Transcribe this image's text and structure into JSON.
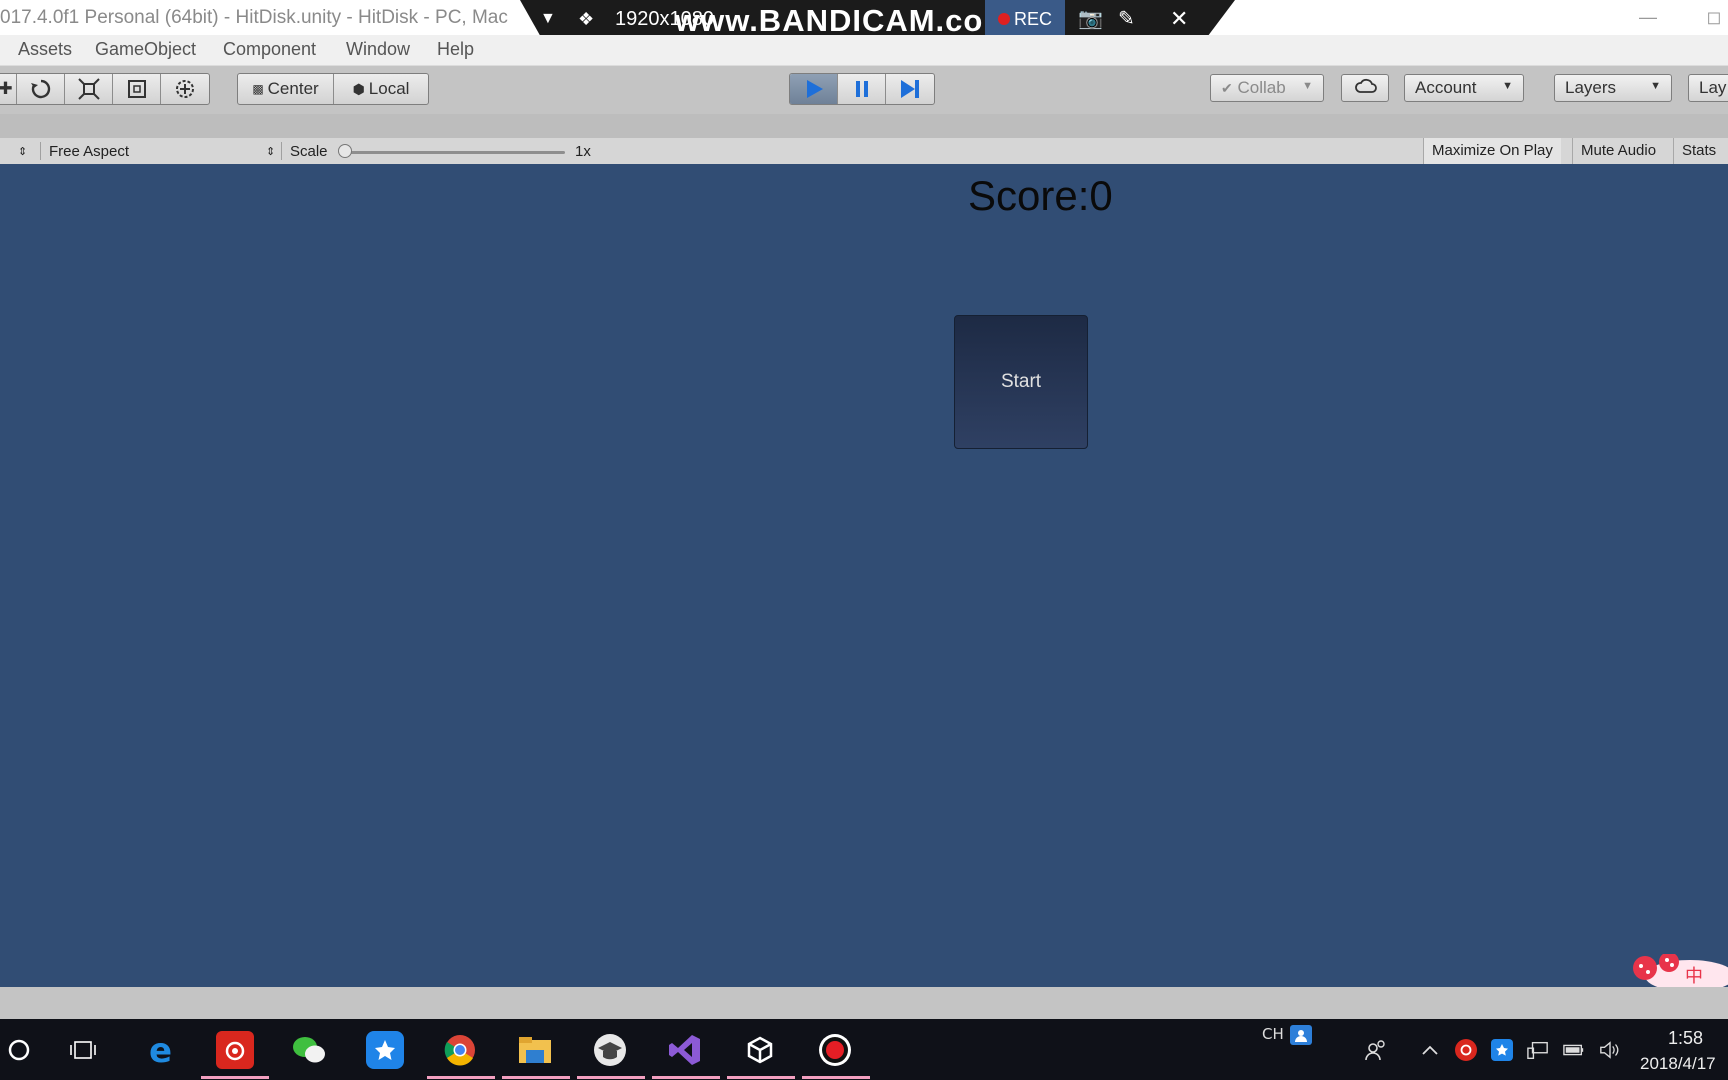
{
  "window": {
    "title": "017.4.0f1 Personal (64bit) - HitDisk.unity - HitDisk - PC, Mac",
    "minimize_icon": "minimize-icon",
    "maximize_icon": "maximize-icon"
  },
  "bandicam": {
    "resolution": "1920x1080",
    "watermark": "www.BANDICAM.com",
    "rec_label": "REC"
  },
  "menu": [
    "Assets",
    "GameObject",
    "Component",
    "Window",
    "Help"
  ],
  "toolbar": {
    "pivot_label": "Center",
    "space_label": "Local",
    "collab_label": "Collab",
    "account_label": "Account",
    "layers_label": "Layers",
    "layout_label": "Lay"
  },
  "game_view": {
    "aspect": "Free Aspect",
    "scale_label": "Scale",
    "scale_value": "1x",
    "scale_level": 0.0,
    "maximize_on_play": "Maximize On Play",
    "mute_audio": "Mute Audio",
    "stats": "Stats"
  },
  "game": {
    "score_text": "Score:0",
    "start_label": "Start",
    "background_color": "#314d74"
  },
  "taskbar": {
    "apps": [
      "cortana-icon",
      "task-view-icon",
      "edge-icon",
      "netease-music-icon",
      "wechat-icon",
      "baidu-netdisk-icon",
      "chrome-icon",
      "file-explorer-icon",
      "edu-icon",
      "visual-studio-icon",
      "unity-icon",
      "bandicam-icon"
    ],
    "lang": "CH",
    "time": "1:58",
    "date": "2018/4/17"
  },
  "ime": {
    "label": "中"
  }
}
